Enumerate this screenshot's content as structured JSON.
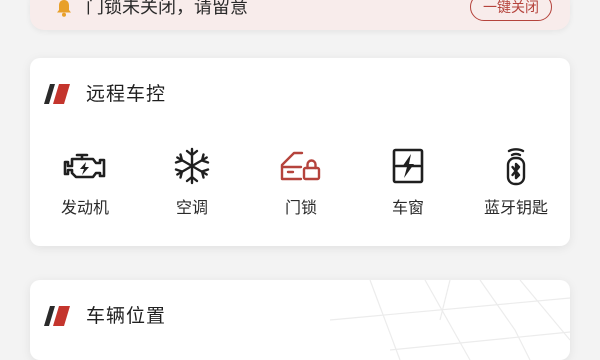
{
  "alert": {
    "message": "门锁未关闭，请留意",
    "action_label": "一键关闭",
    "icon": "bell-icon",
    "accent": "#e8a02a",
    "button_color": "#b5433c"
  },
  "remote_control": {
    "title": "远程车控",
    "logo_color": "#c4352d",
    "items": [
      {
        "label": "发动机",
        "icon": "engine-icon"
      },
      {
        "label": "空调",
        "icon": "snowflake-icon"
      },
      {
        "label": "门锁",
        "icon": "door-lock-icon",
        "highlight_color": "#b5433c"
      },
      {
        "label": "车窗",
        "icon": "car-window-icon"
      },
      {
        "label": "蓝牙钥匙",
        "icon": "bluetooth-key-icon"
      }
    ]
  },
  "vehicle_location": {
    "title": "车辆位置"
  }
}
